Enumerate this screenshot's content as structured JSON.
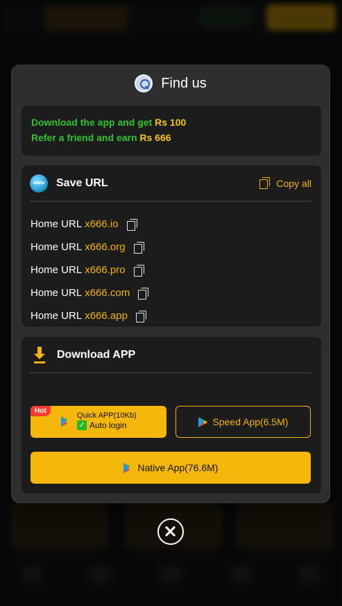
{
  "modal": {
    "title": "Find us",
    "title_icon": "search-globe-icon"
  },
  "promo": {
    "line1_text": "Download the app and get ",
    "line1_amount": "Rs 100",
    "line2_text": "Refer a friend and earn ",
    "line2_amount": "Rs 666"
  },
  "save_url": {
    "title": "Save URL",
    "icon": "www-globe-icon",
    "copy_all_label": "Copy all",
    "urls": [
      {
        "label": "Home URL",
        "link": "x666.io"
      },
      {
        "label": "Home URL",
        "link": "x666.org"
      },
      {
        "label": "Home URL",
        "link": "x666.pro"
      },
      {
        "label": "Home URL",
        "link": "x666.com"
      },
      {
        "label": "Home URL",
        "link": "x666.app"
      }
    ]
  },
  "download": {
    "title": "Download APP",
    "icon": "download-icon",
    "quick": {
      "badge": "Hot",
      "title": "Quick APP(10Kb)",
      "subtitle": "Auto login"
    },
    "speed_label": "Speed App(6.5M)",
    "native_label": "Native App(76.6M)"
  },
  "colors": {
    "accent": "#f5b40a",
    "promo_green": "#31c431",
    "amount_yellow": "#f5c518",
    "hot_red": "#ff3b30",
    "modal_bg": "#2e2e2e",
    "panel_bg": "#1c1c1c"
  }
}
